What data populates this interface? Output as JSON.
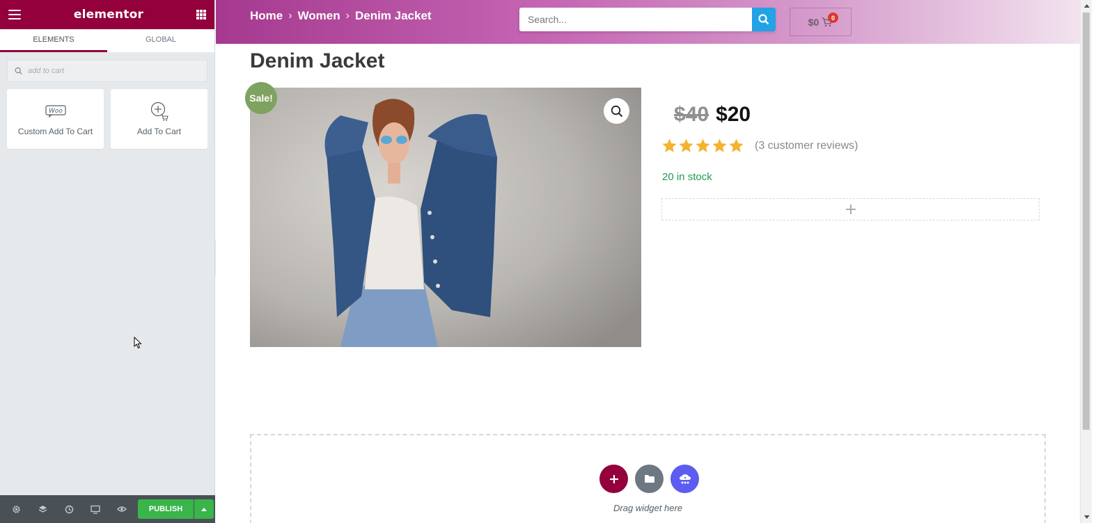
{
  "panel": {
    "logo": "elementor",
    "tabs": [
      "ELEMENTS",
      "GLOBAL"
    ],
    "search_placeholder": "add to cart",
    "widgets": [
      {
        "label": "Custom Add To Cart",
        "icon": "woo-icon"
      },
      {
        "label": "Add To Cart",
        "icon": "add-to-cart-icon"
      }
    ],
    "footer": {
      "icons": [
        "settings-icon",
        "layers-icon",
        "history-icon",
        "responsive-icon",
        "preview-eye-icon"
      ],
      "publish_label": "PUBLISH"
    }
  },
  "site": {
    "breadcrumb": [
      "Home",
      "Women",
      "Denim Jacket"
    ],
    "search_placeholder": "Search...",
    "cart_total": "$0",
    "cart_count": "0"
  },
  "product": {
    "title": "Denim Jacket",
    "sale_badge": "Sale!",
    "price_old": "$40",
    "price_new": "$20",
    "rating": 5,
    "reviews": "(3 customer reviews)",
    "stock": "20 in stock"
  },
  "drop_area": {
    "hint": "Drag widget here"
  },
  "colors": {
    "brand": "#93003c",
    "publish": "#39b54a",
    "search_button": "#21a3e6",
    "sale": "#7ea360",
    "stock": "#1f9c52",
    "star": "#f4b22d",
    "template_button": "#6d7882",
    "ai_button": "#5c5cf0"
  }
}
